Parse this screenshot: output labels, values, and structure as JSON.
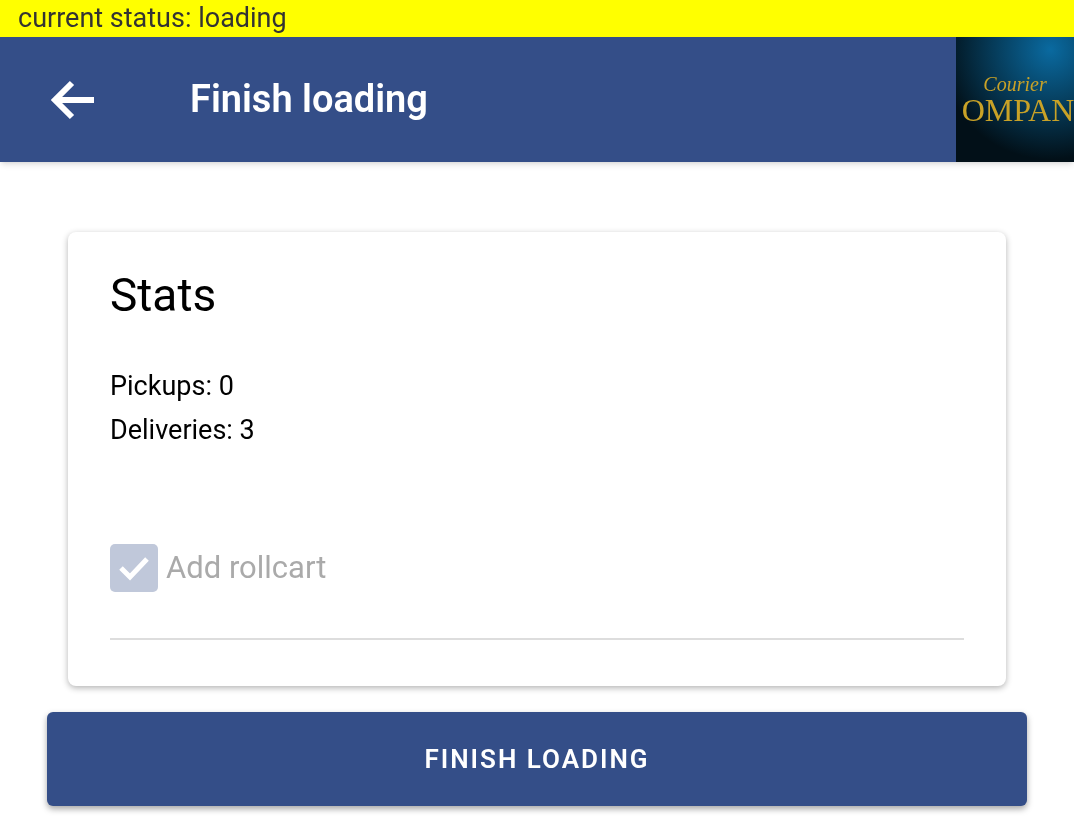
{
  "status_banner": "current status: loading",
  "app_bar": {
    "title": "Finish loading",
    "logo": {
      "line_1": "Courier",
      "line_2": "OMPAN"
    }
  },
  "stats_card": {
    "title": "Stats",
    "lines": [
      "Pickups: 0",
      "Deliveries: 3"
    ],
    "checkbox": {
      "label": "Add rollcart",
      "checked": true,
      "disabled": true
    }
  },
  "primary_button": "FINISH LOADING"
}
